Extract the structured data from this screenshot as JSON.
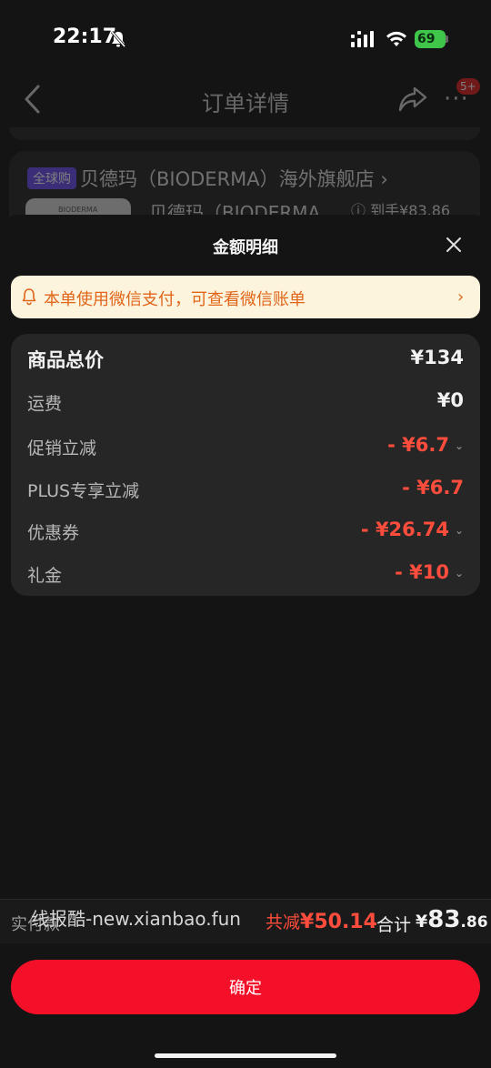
{
  "status_bar": {
    "time": "22:17",
    "battery": "69"
  },
  "header": {
    "title": "订单详情",
    "more_badge": "5+"
  },
  "store": {
    "tag": "全球购",
    "name": "贝德玛（BIODERMA）海外旗舰店 ›",
    "product_thumb_text": "BIODERMA",
    "product_name": "贝德玛（BIODERMA",
    "price_hint": "ⓘ 到手¥83.86"
  },
  "sheet": {
    "title": "金额明细",
    "notice": "本单使用微信支付，可查看微信账单",
    "rows": [
      {
        "label": "商品总价",
        "value": "¥134"
      },
      {
        "label": "运费",
        "value": "¥0"
      },
      {
        "label": "促销立减",
        "value": "- ¥6.7"
      },
      {
        "label": "PLUS专享立减",
        "value": "- ¥6.7"
      },
      {
        "label": "优惠券",
        "value": "- ¥26.74"
      },
      {
        "label": "礼金",
        "value": "- ¥10"
      }
    ]
  },
  "footer": {
    "paid_label": "实付款",
    "watermark": "线报酷-new.xianbao.fun",
    "reduce_label": "共减",
    "reduce_value": "¥50.14",
    "total_label": "合计",
    "total_currency": "¥",
    "total_int": "83",
    "total_dec": ".86",
    "confirm": "确定"
  },
  "colors": {
    "accent": "#f5102a",
    "discount": "#ff4d3d",
    "notice_bg": "#fdf4de",
    "notice_text": "#e0661a"
  },
  "icons": [
    "bell-slash-icon",
    "signal-icon",
    "wifi-icon",
    "back-icon",
    "share-icon",
    "more-icon",
    "close-icon",
    "bell-icon",
    "chevron-right-icon",
    "chevron-down-icon"
  ]
}
